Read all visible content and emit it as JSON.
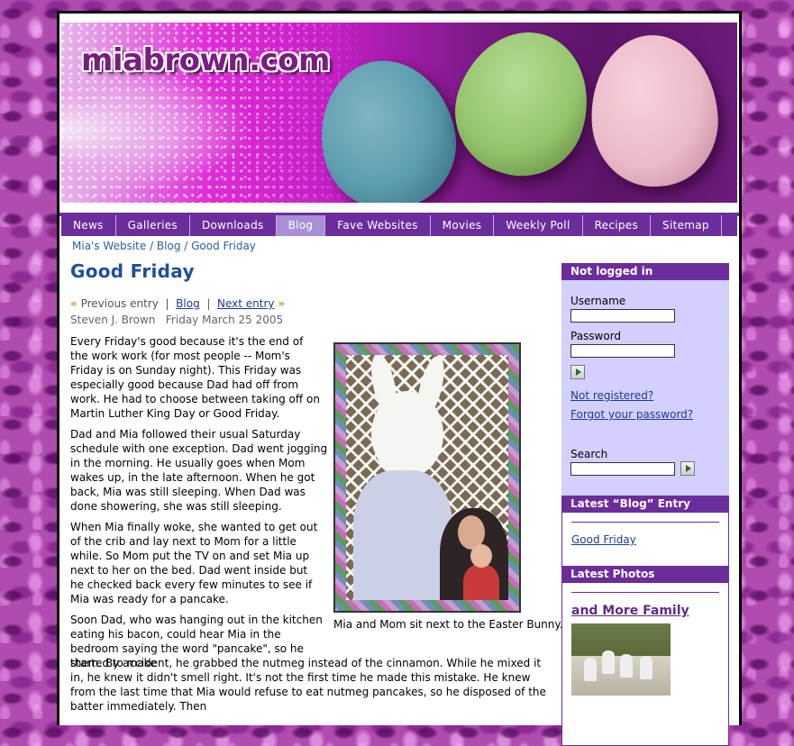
{
  "site": {
    "logo_text": "miabrown.com"
  },
  "nav": {
    "items": [
      {
        "label": "News"
      },
      {
        "label": "Galleries"
      },
      {
        "label": "Downloads"
      },
      {
        "label": "Blog",
        "active": true
      },
      {
        "label": "Fave Websites"
      },
      {
        "label": "Movies"
      },
      {
        "label": "Weekly Poll"
      },
      {
        "label": "Recipes"
      },
      {
        "label": "Sitemap"
      }
    ],
    "colors": {
      "bar": "#6c2d9c",
      "active": "#a98fd6"
    }
  },
  "breadcrumb": {
    "items": [
      "Mia's Website",
      "Blog",
      "Good Friday"
    ],
    "separator": " / "
  },
  "entry": {
    "title": "Good Friday",
    "prev_label": "Previous entry",
    "blog_label": "Blog",
    "next_label": "Next entry",
    "author": "Steven J. Brown",
    "date": "Friday March 25 2005",
    "paragraphs": [
      "Every Friday's good because it's the end of the work work (for most people -- Mom's Friday is on Sunday night). This Friday was especially good because Dad had off from work. He had to choose between taking off on Martin Luther King Day or Good Friday.",
      "Dad and Mia followed their usual Saturday schedule with one exception. Dad went jogging in the morning. He usually goes when Mom wakes up, in the late afternoon. When he got back, Mia was still sleeping. When Dad was done showering, she was still sleeping.",
      "When Mia finally woke, she wanted to get out of the crib and lay next to Mom for a little while. So Mom put the TV on and set Mia up next to her on the bed. Dad went inside but he checked back every few minutes to see if Mia was ready for a pancake.",
      "Soon Dad, who was hanging out in the kitchen eating his bacon, could hear Mia in the bedroom saying the word \"pancake\", so he started to make",
      "them. By accident, he grabbed the nutmeg instead of the cinnamon. While he mixed it in, he knew it didn't smell right. It's not the first time he made this mistake. He knew from the last time that Mia would refuse to eat nutmeg pancakes, so he disposed of the batter immediately. Then"
    ],
    "photo_caption": "Mia and Mom sit next to the Easter Bunny."
  },
  "sidebar": {
    "login": {
      "heading": "Not logged in",
      "username_label": "Username",
      "password_label": "Password",
      "not_registered": "Not registered?",
      "forgot_password": "Forgot your password?"
    },
    "search": {
      "label": "Search"
    },
    "latest_blog": {
      "heading": "Latest “Blog” Entry",
      "link": "Good Friday"
    },
    "latest_photos": {
      "heading": "Latest Photos",
      "album_title": "and More Family"
    }
  }
}
